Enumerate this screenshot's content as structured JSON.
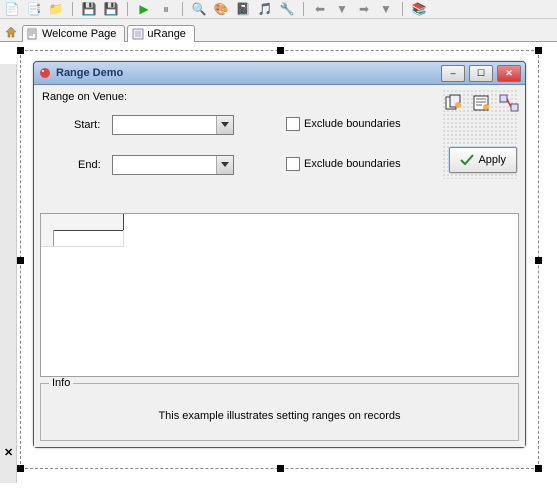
{
  "toolbar": {
    "icons": [
      "doc",
      "doc-multi",
      "folder-db",
      "save",
      "save-all",
      "play-green",
      "pause",
      "view",
      "palette",
      "book",
      "music",
      "tool",
      "arrow-left",
      "arrow-down",
      "arrow-right",
      "arrow-up",
      "stack"
    ]
  },
  "tabs": {
    "welcome": "Welcome Page",
    "urange": "uRange"
  },
  "window": {
    "title": "Range Demo",
    "buttons": {
      "min": "–",
      "max": "☐",
      "close": "✕"
    }
  },
  "form": {
    "group_label": "Range on Venue:",
    "start_label": "Start:",
    "end_label": "End:",
    "start_value": "",
    "end_value": "",
    "exclude1_label": "Exclude boundaries",
    "exclude2_label": "Exclude boundaries",
    "apply_label": "Apply"
  },
  "info": {
    "title": "Info",
    "text": "This example illustrates setting ranges on records"
  }
}
